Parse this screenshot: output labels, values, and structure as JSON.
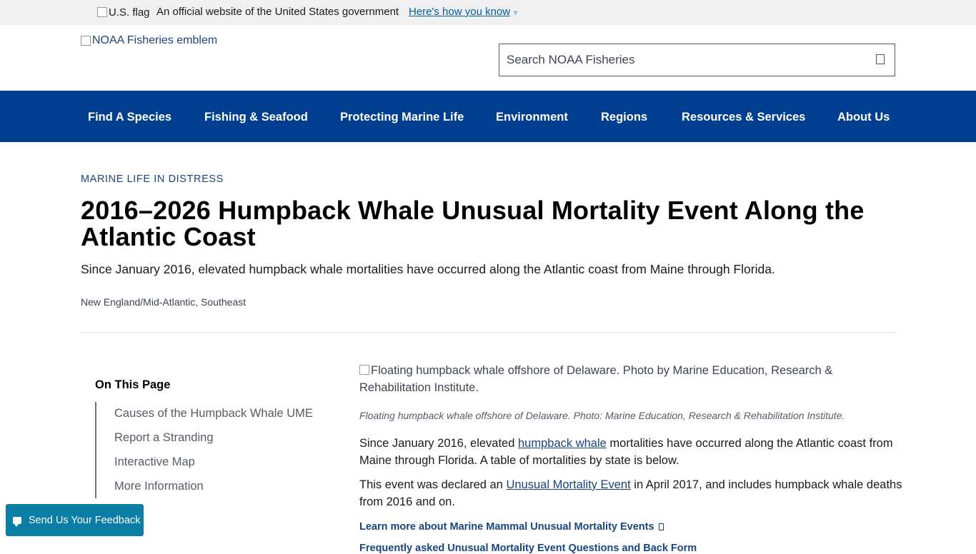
{
  "gov_banner": {
    "flag_alt": "U.S. flag",
    "official_text": "An official website of the United States government",
    "how_you_know": "Here's how you know"
  },
  "header": {
    "emblem_alt": "NOAA Fisheries emblem",
    "search_placeholder": "Search NOAA Fisheries"
  },
  "nav": {
    "items": [
      "Find A Species",
      "Fishing & Seafood",
      "Protecting Marine Life",
      "Environment",
      "Regions",
      "Resources & Services",
      "About Us"
    ]
  },
  "page": {
    "eyebrow": "MARINE LIFE IN DISTRESS",
    "title": "2016–2026 Humpback Whale Unusual Mortality Event Along the Atlantic Coast",
    "subtitle": "Since January 2016, elevated humpback whale mortalities have occurred along the Atlantic coast from Maine through Florida.",
    "regions": "New England/Mid-Atlantic, Southeast"
  },
  "on_this_page": {
    "title": "On This Page",
    "links": [
      "Causes of the Humpback Whale UME",
      "Report a Stranding",
      "Interactive Map",
      "More Information"
    ]
  },
  "content": {
    "image_alt": "Floating humpback whale offshore of Delaware. Photo by Marine Education, Research & Rehabilitation Institute.",
    "caption": "Floating humpback whale offshore of Delaware. Photo: Marine Education, Research & Rehabilitation Institute.",
    "p1_before": "Since January 2016, elevated ",
    "p1_link": "humpback whale",
    "p1_after": " mortalities have occurred along the Atlantic coast from Maine through Florida. A table of mortalities by state is below.",
    "p2_before": "This event was declared an ",
    "p2_link": "Unusual Mortality Event",
    "p2_after": " in April 2017, and includes humpback whale deaths from 2016 and on.",
    "learn_more": "Learn more about Marine Mammal Unusual Mortality Events",
    "learn_more_2": "Frequently asked Unusual Mortality Event Questions and Back Form"
  },
  "feedback": {
    "label": "Send Us Your Feedback"
  }
}
